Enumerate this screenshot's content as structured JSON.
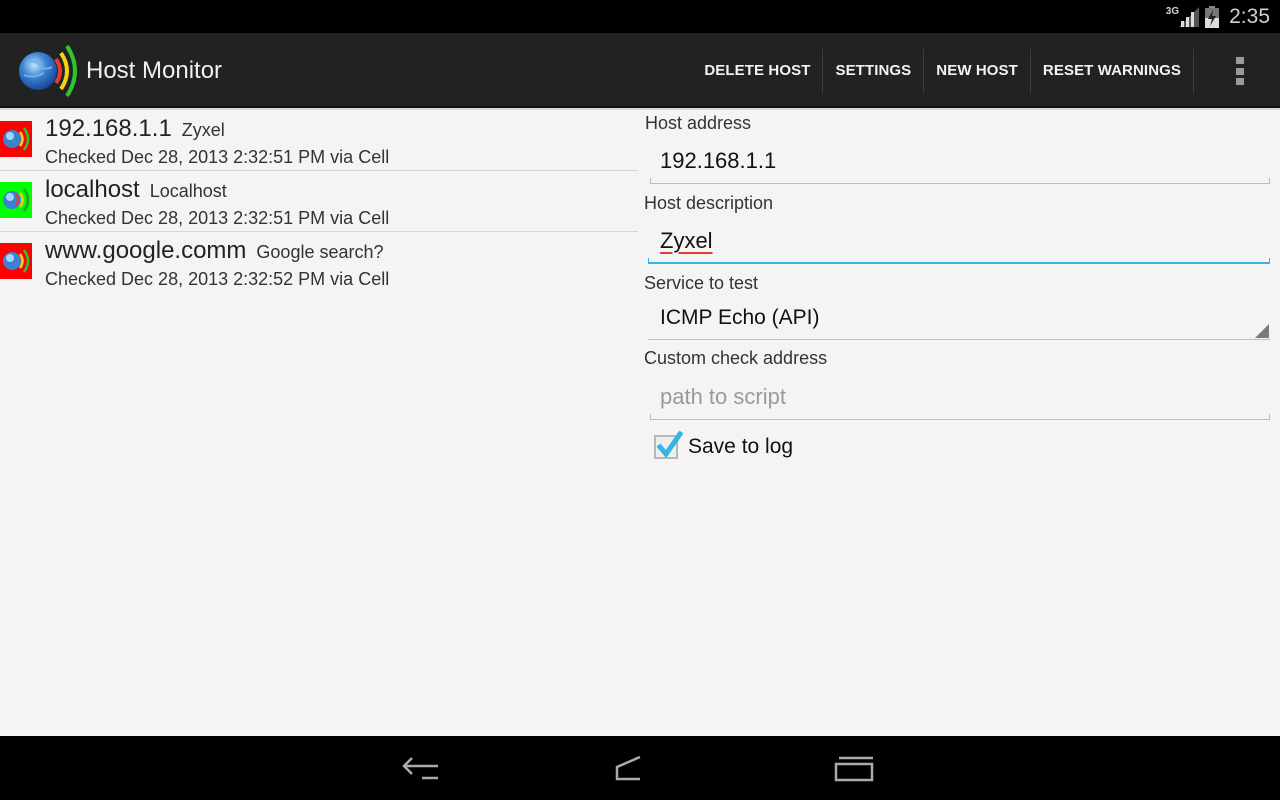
{
  "status_bar": {
    "network": "3G",
    "signal_icon": "signal-icon",
    "battery_icon": "battery-charging-icon",
    "time": "2:35"
  },
  "action_bar": {
    "app_title": "Host Monitor",
    "actions": [
      "DELETE HOST",
      "SETTINGS",
      "NEW HOST",
      "RESET WARNINGS"
    ],
    "overflow_icon": "overflow-menu-icon"
  },
  "hosts": [
    {
      "name": "192.168.1.1",
      "description": "Zyxel",
      "status_text": "Checked Dec 28, 2013 2:32:51 PM via Cell",
      "state": "down",
      "state_color": "#ff0000"
    },
    {
      "name": "localhost",
      "description": "Localhost",
      "status_text": "Checked Dec 28, 2013 2:32:51 PM via Cell",
      "state": "up",
      "state_color": "#00ff00"
    },
    {
      "name": "www.google.comm",
      "description": "Google search?",
      "status_text": "Checked Dec 28, 2013 2:32:52 PM via Cell",
      "state": "down",
      "state_color": "#ff0000"
    }
  ],
  "form": {
    "host_address_label": "Host address",
    "host_address_value": "192.168.1.1",
    "host_description_label": "Host description",
    "host_description_value": "Zyxel",
    "service_label": "Service to test",
    "service_value": "ICMP Echo (API)",
    "custom_check_label": "Custom check address",
    "custom_check_placeholder": "path to script",
    "save_to_log_label": "Save to log",
    "save_to_log_checked": true
  },
  "colors": {
    "accent": "#33b5e5",
    "action_bar_bg": "#222222",
    "spellcheck": "#e53935"
  }
}
